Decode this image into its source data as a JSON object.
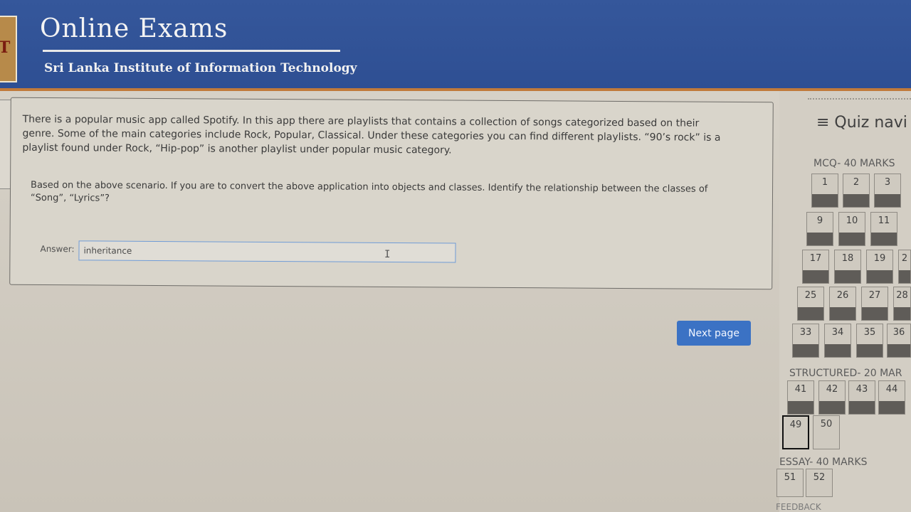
{
  "header": {
    "logo_letter": "T",
    "title": "Online Exams",
    "institute": "Sri Lanka Institute of Information Technology"
  },
  "question": {
    "scenario": "There is a popular music app called Spotify. In this app there are playlists that contains a collection of songs categorized based on their genre. Some of the main categories include Rock, Popular, Classical. Under these categories you can find different playlists. “90’s rock” is a playlist found under Rock, “Hip-pop” is another playlist under popular music category.",
    "prompt": "Based on the above scenario. If you are to convert the above application into objects and classes. Identify the relationship between the classes of “Song”, “Lyrics”?",
    "answer_label": "Answer:",
    "answer_value": "inheritance"
  },
  "actions": {
    "next_label": "Next page"
  },
  "nav": {
    "title": "≡ Quiz navi",
    "sections": {
      "mcq": "MCQ- 40 MARKS",
      "structured": "STRUCTURED- 20 MAR",
      "essay": "ESSAY- 40 MARKS",
      "feedback": "FEEDBACK"
    },
    "buttons": [
      "1",
      "2",
      "3",
      "9",
      "10",
      "11",
      "17",
      "18",
      "19",
      "2",
      "25",
      "26",
      "27",
      "28",
      "33",
      "34",
      "35",
      "36",
      "41",
      "42",
      "43",
      "44",
      "49",
      "50",
      "51",
      "52"
    ]
  }
}
